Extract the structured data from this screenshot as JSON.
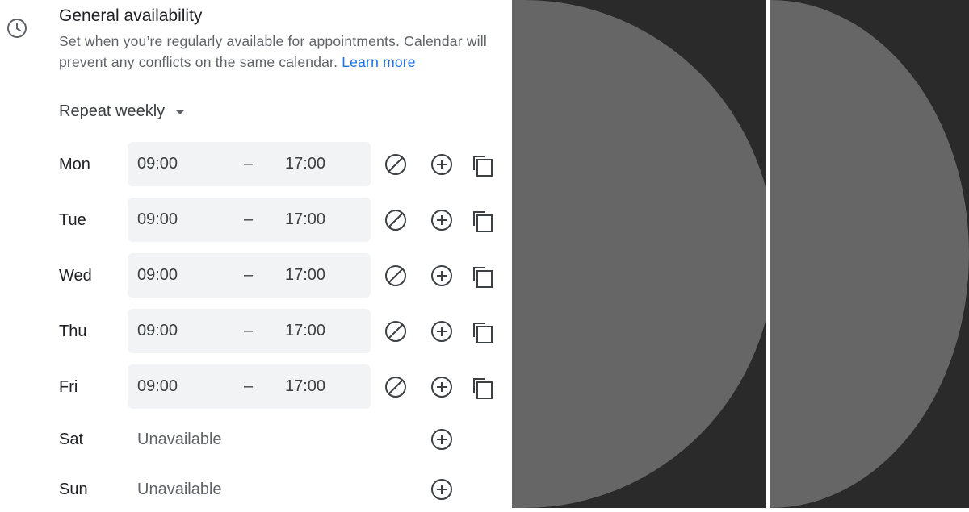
{
  "header": {
    "title": "General availability",
    "description": "Set when you’re regularly available for appointments. Calendar will prevent any conflicts on the same calendar.",
    "learn_more": "Learn more"
  },
  "repeat": {
    "label": "Repeat weekly"
  },
  "days": [
    {
      "day": "Mon",
      "start": "09:00",
      "separator": "–",
      "end": "17:00"
    },
    {
      "day": "Tue",
      "start": "09:00",
      "separator": "–",
      "end": "17:00"
    },
    {
      "day": "Wed",
      "start": "09:00",
      "separator": "–",
      "end": "17:00"
    },
    {
      "day": "Thu",
      "start": "09:00",
      "separator": "–",
      "end": "17:00"
    },
    {
      "day": "Fri",
      "start": "09:00",
      "separator": "–",
      "end": "17:00"
    },
    {
      "day": "Sat",
      "status": "Unavailable"
    },
    {
      "day": "Sun",
      "status": "Unavailable"
    }
  ],
  "icons": {
    "section": "clock-icon",
    "row_actions": [
      "unavailable-icon",
      "add-icon",
      "copy-icon"
    ]
  },
  "colors": {
    "accent_link": "#1a73e8",
    "text_primary": "#202124",
    "text_secondary": "#5f6368",
    "field_bg": "#f1f3f4",
    "art_dark": "#2a2a2a",
    "art_light": "#666666"
  }
}
